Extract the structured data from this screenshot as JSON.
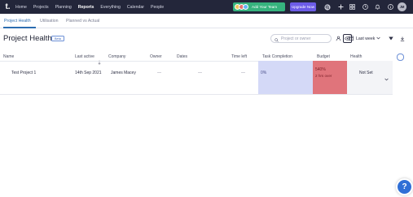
{
  "logo": {
    "text": "t."
  },
  "nav": {
    "items": [
      {
        "label": "Home"
      },
      {
        "label": "Projects"
      },
      {
        "label": "Planning"
      },
      {
        "label": "Reports",
        "active": true
      },
      {
        "label": "Everything"
      },
      {
        "label": "Calendar"
      },
      {
        "label": "People"
      }
    ],
    "team_button": "Add Your Team",
    "upgrade_button": "Upgrade Now",
    "user_initials": "JM"
  },
  "subtabs": {
    "items": [
      {
        "label": "Project Health",
        "active": true
      },
      {
        "label": "Utilisation"
      },
      {
        "label": "Planned vs Actual"
      }
    ]
  },
  "page": {
    "title": "Project Health",
    "badge": "Beta",
    "search_placeholder": "Project or owner",
    "period": "Last week"
  },
  "table": {
    "headers": {
      "name": "Name",
      "last_active": "Last active",
      "company": "Company",
      "owner": "Owner",
      "dates": "Dates",
      "time_left": "Time left",
      "task_completion": "Task Completion",
      "budget": "Budget",
      "health": "Health"
    },
    "rows": [
      {
        "name": "Test Project 1",
        "last_active": "14th Sep 2021",
        "company": "James Macey",
        "owner": "—",
        "dates": "—",
        "time_left": "—",
        "task_completion": "0%",
        "budget_pct": "540%",
        "budget_note": "2 hrs over",
        "health": "Not Set"
      }
    ]
  },
  "colors": {
    "nav_bg": "#23263a",
    "team_green": "#36b37e",
    "upgrade_purple": "#6c5ce7",
    "task_bg": "#d4d9f7",
    "budget_red": "#e0747b",
    "help_blue": "#2f6fd6"
  },
  "icons": {
    "search": "search-icon",
    "plus": "plus-icon",
    "grid": "grid-icon",
    "clock": "clock-icon",
    "bell": "bell-icon",
    "help": "help-icon"
  }
}
